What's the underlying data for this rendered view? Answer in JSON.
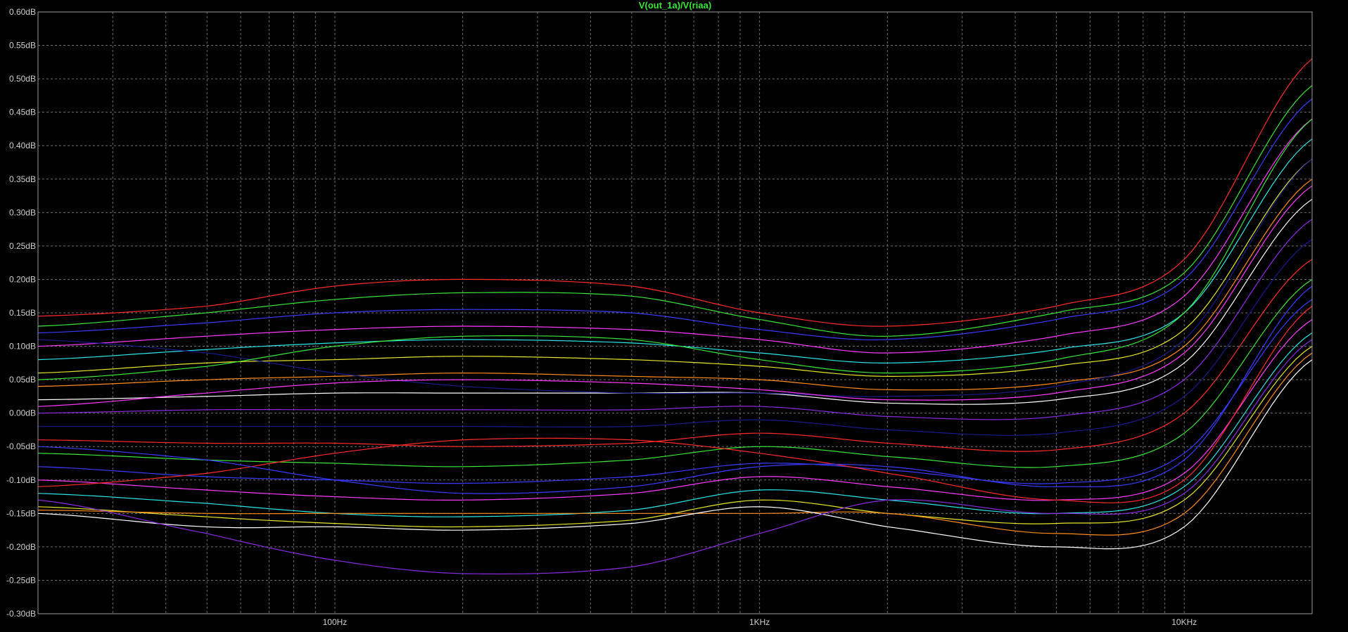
{
  "chart_data": {
    "type": "line",
    "title": "V(out_1a)/V(riaa)",
    "x_scale": "log",
    "xlim": [
      20,
      20000
    ],
    "ylim": [
      -0.3,
      0.6
    ],
    "y_unit": "dB",
    "grid": true,
    "background": "#000000",
    "grid_color": "#6e6e6e",
    "title_color": "#39e639",
    "x_ticks": [
      {
        "value": 100,
        "label": "100Hz"
      },
      {
        "value": 1000,
        "label": "1KHz"
      },
      {
        "value": 10000,
        "label": "10KHz"
      }
    ],
    "y_ticks": [
      {
        "value": 0.6,
        "label": "0.60dB"
      },
      {
        "value": 0.55,
        "label": "0.55dB"
      },
      {
        "value": 0.5,
        "label": "0.50dB"
      },
      {
        "value": 0.45,
        "label": "0.45dB"
      },
      {
        "value": 0.4,
        "label": "0.40dB"
      },
      {
        "value": 0.35,
        "label": "0.35dB"
      },
      {
        "value": 0.3,
        "label": "0.30dB"
      },
      {
        "value": 0.25,
        "label": "0.25dB"
      },
      {
        "value": 0.2,
        "label": "0.20dB"
      },
      {
        "value": 0.15,
        "label": "0.15dB"
      },
      {
        "value": 0.1,
        "label": "0.10dB"
      },
      {
        "value": 0.05,
        "label": "0.05dB"
      },
      {
        "value": 0.0,
        "label": "0.00dB"
      },
      {
        "value": -0.05,
        "label": "-0.05dB"
      },
      {
        "value": -0.1,
        "label": "-0.10dB"
      },
      {
        "value": -0.15,
        "label": "-0.15dB"
      },
      {
        "value": -0.2,
        "label": "-0.20dB"
      },
      {
        "value": -0.25,
        "label": "-0.25dB"
      },
      {
        "value": -0.3,
        "label": "-0.30dB"
      }
    ],
    "x": [
      20,
      50,
      100,
      200,
      500,
      1000,
      2000,
      5000,
      10000,
      20000
    ],
    "series_colors": [
      "#ff2a2a",
      "#39e639",
      "#3a3aff",
      "#ff3aff",
      "#2ae6e6",
      "#e6e62a",
      "#ff8c1a",
      "#ffffff",
      "#8a2be2",
      "#1a1a8c"
    ],
    "series": [
      {
        "values": [
          0.145,
          0.16,
          0.19,
          0.2,
          0.19,
          0.15,
          0.13,
          0.16,
          0.23,
          0.53
        ]
      },
      {
        "values": [
          0.13,
          0.15,
          0.17,
          0.18,
          0.175,
          0.14,
          0.115,
          0.15,
          0.21,
          0.49
        ]
      },
      {
        "values": [
          0.12,
          0.135,
          0.15,
          0.155,
          0.15,
          0.125,
          0.11,
          0.14,
          0.2,
          0.47
        ]
      },
      {
        "values": [
          0.1,
          0.115,
          0.125,
          0.13,
          0.125,
          0.11,
          0.09,
          0.115,
          0.175,
          0.44
        ]
      },
      {
        "values": [
          0.08,
          0.095,
          0.105,
          0.11,
          0.105,
          0.09,
          0.075,
          0.095,
          0.15,
          0.41
        ]
      },
      {
        "values": [
          0.06,
          0.075,
          0.08,
          0.085,
          0.08,
          0.07,
          0.055,
          0.07,
          0.125,
          0.38
        ]
      },
      {
        "values": [
          0.04,
          0.05,
          0.055,
          0.06,
          0.055,
          0.05,
          0.035,
          0.045,
          0.1,
          0.35
        ]
      },
      {
        "values": [
          0.02,
          0.025,
          0.03,
          0.03,
          0.03,
          0.03,
          0.015,
          0.02,
          0.075,
          0.32
        ]
      },
      {
        "values": [
          0.0,
          0.005,
          0.005,
          0.005,
          0.005,
          0.01,
          -0.005,
          -0.005,
          0.05,
          0.29
        ]
      },
      {
        "values": [
          -0.02,
          -0.02,
          -0.02,
          -0.02,
          -0.02,
          -0.01,
          -0.025,
          -0.03,
          0.025,
          0.26
        ]
      },
      {
        "values": [
          -0.04,
          -0.045,
          -0.045,
          -0.05,
          -0.045,
          -0.03,
          -0.045,
          -0.055,
          0.0,
          0.23
        ]
      },
      {
        "values": [
          -0.06,
          -0.07,
          -0.075,
          -0.08,
          -0.07,
          -0.05,
          -0.065,
          -0.08,
          -0.03,
          0.2
        ]
      },
      {
        "values": [
          -0.08,
          -0.095,
          -0.1,
          -0.105,
          -0.095,
          -0.075,
          -0.085,
          -0.105,
          -0.06,
          0.17
        ]
      },
      {
        "values": [
          -0.1,
          -0.115,
          -0.125,
          -0.13,
          -0.12,
          -0.095,
          -0.11,
          -0.13,
          -0.09,
          0.14
        ]
      },
      {
        "values": [
          -0.12,
          -0.135,
          -0.15,
          -0.155,
          -0.145,
          -0.115,
          -0.13,
          -0.15,
          -0.11,
          0.12
        ]
      },
      {
        "values": [
          -0.14,
          -0.155,
          -0.165,
          -0.17,
          -0.16,
          -0.13,
          -0.15,
          -0.165,
          -0.13,
          0.1
        ]
      },
      {
        "values": [
          -0.145,
          -0.15,
          -0.15,
          -0.15,
          -0.15,
          -0.15,
          -0.15,
          -0.18,
          -0.15,
          0.09
        ]
      },
      {
        "values": [
          -0.15,
          -0.17,
          -0.17,
          -0.175,
          -0.165,
          -0.14,
          -0.17,
          -0.2,
          -0.17,
          0.08
        ]
      },
      {
        "values": [
          -0.13,
          -0.18,
          -0.22,
          -0.24,
          -0.23,
          -0.18,
          -0.13,
          -0.15,
          -0.12,
          0.11
        ]
      },
      {
        "values": [
          0.11,
          0.09,
          0.06,
          0.04,
          0.03,
          0.03,
          0.025,
          0.04,
          0.11,
          0.38
        ]
      },
      {
        "values": [
          -0.11,
          -0.09,
          -0.06,
          -0.04,
          -0.04,
          -0.06,
          -0.09,
          -0.13,
          -0.1,
          0.16
        ]
      },
      {
        "values": [
          0.05,
          0.07,
          0.1,
          0.115,
          0.11,
          0.08,
          0.06,
          0.08,
          0.15,
          0.44
        ]
      },
      {
        "values": [
          -0.05,
          -0.07,
          -0.1,
          -0.12,
          -0.11,
          -0.08,
          -0.08,
          -0.11,
          -0.07,
          0.19
        ]
      },
      {
        "values": [
          0.01,
          0.03,
          0.045,
          0.05,
          0.045,
          0.035,
          0.02,
          0.03,
          0.09,
          0.34
        ]
      }
    ]
  }
}
